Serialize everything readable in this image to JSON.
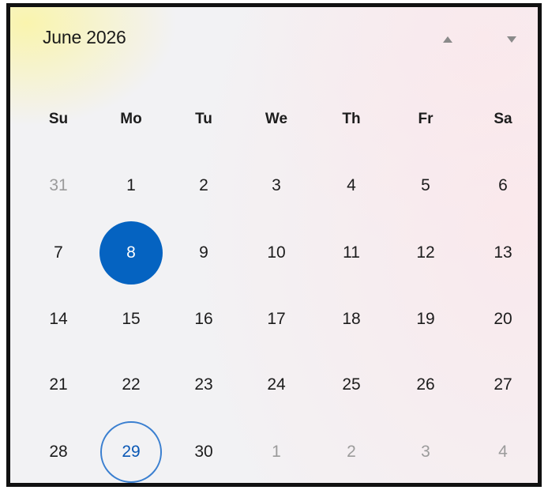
{
  "calendar": {
    "month_title": "June 2026",
    "prev_icon": "triangle-up-icon",
    "next_icon": "triangle-down-icon",
    "nav_icon_color": "#8a8a8a",
    "weekdays": [
      "Su",
      "Mo",
      "Tu",
      "We",
      "Th",
      "Fr",
      "Sa"
    ],
    "weeks": [
      [
        {
          "label": "31",
          "state": "other"
        },
        {
          "label": "1",
          "state": ""
        },
        {
          "label": "2",
          "state": ""
        },
        {
          "label": "3",
          "state": ""
        },
        {
          "label": "4",
          "state": ""
        },
        {
          "label": "5",
          "state": ""
        },
        {
          "label": "6",
          "state": ""
        }
      ],
      [
        {
          "label": "7",
          "state": ""
        },
        {
          "label": "8",
          "state": "selected"
        },
        {
          "label": "9",
          "state": ""
        },
        {
          "label": "10",
          "state": ""
        },
        {
          "label": "11",
          "state": ""
        },
        {
          "label": "12",
          "state": ""
        },
        {
          "label": "13",
          "state": ""
        }
      ],
      [
        {
          "label": "14",
          "state": ""
        },
        {
          "label": "15",
          "state": ""
        },
        {
          "label": "16",
          "state": ""
        },
        {
          "label": "17",
          "state": ""
        },
        {
          "label": "18",
          "state": ""
        },
        {
          "label": "19",
          "state": ""
        },
        {
          "label": "20",
          "state": ""
        }
      ],
      [
        {
          "label": "21",
          "state": ""
        },
        {
          "label": "22",
          "state": ""
        },
        {
          "label": "23",
          "state": ""
        },
        {
          "label": "24",
          "state": ""
        },
        {
          "label": "25",
          "state": ""
        },
        {
          "label": "26",
          "state": ""
        },
        {
          "label": "27",
          "state": ""
        }
      ],
      [
        {
          "label": "28",
          "state": ""
        },
        {
          "label": "29",
          "state": "today"
        },
        {
          "label": "30",
          "state": ""
        },
        {
          "label": "1",
          "state": "other"
        },
        {
          "label": "2",
          "state": "other"
        },
        {
          "label": "3",
          "state": "other"
        },
        {
          "label": "4",
          "state": "other"
        }
      ]
    ],
    "colors": {
      "selected_background": "#0563c1",
      "today_border": "#3a7fd0",
      "other_month_text": "#9b9b9b"
    }
  }
}
